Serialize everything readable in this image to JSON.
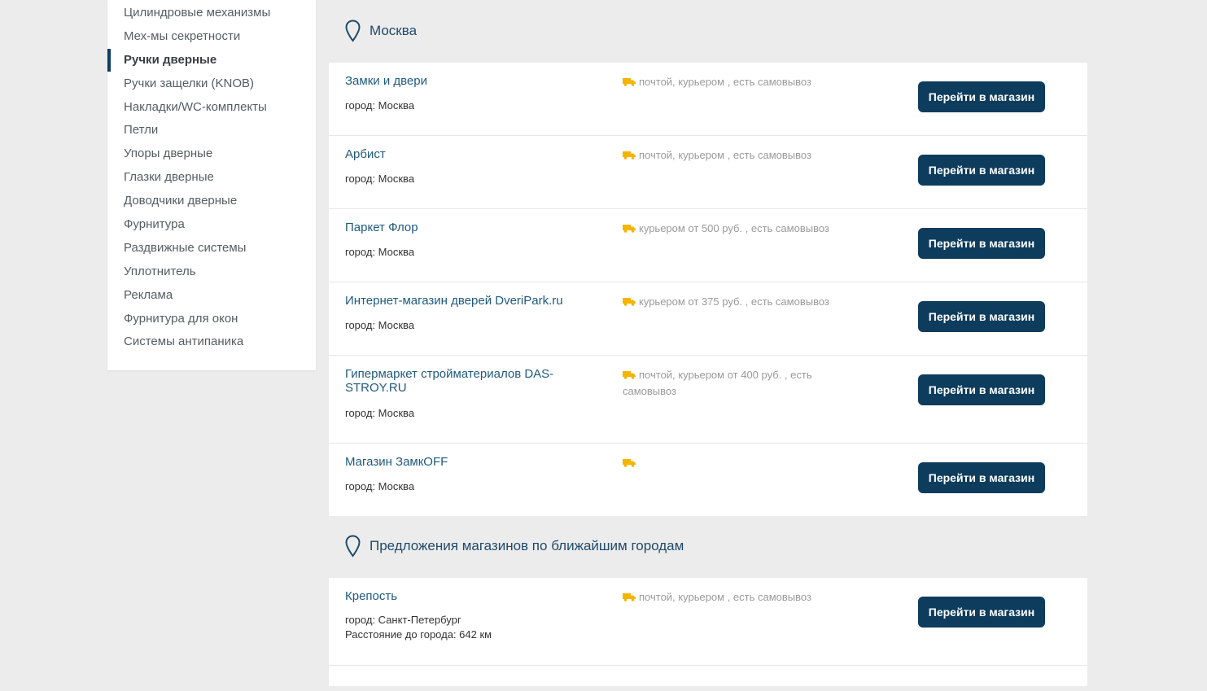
{
  "sidebar": {
    "items": [
      {
        "label": "Цилиндровые механизмы",
        "active": false
      },
      {
        "label": "Мех-мы секретности",
        "active": false
      },
      {
        "label": "Ручки дверные",
        "active": true
      },
      {
        "label": "Ручки защелки (KNOB)",
        "active": false
      },
      {
        "label": "Накладки/WC-комплекты",
        "active": false
      },
      {
        "label": "Петли",
        "active": false
      },
      {
        "label": "Упоры дверные",
        "active": false
      },
      {
        "label": "Глазки дверные",
        "active": false
      },
      {
        "label": "Доводчики дверные",
        "active": false
      },
      {
        "label": "Фурнитура",
        "active": false
      },
      {
        "label": "Раздвижные системы",
        "active": false
      },
      {
        "label": "Уплотнитель",
        "active": false
      },
      {
        "label": "Реклама",
        "active": false
      },
      {
        "label": "Фурнитура для окон",
        "active": false
      },
      {
        "label": "Системы антипаника",
        "active": false
      }
    ]
  },
  "moscow": {
    "title": "Москва",
    "shops": [
      {
        "name": "Замки и двери",
        "city": "город: Москва",
        "delivery": "почтой, курьером , есть самовывоз",
        "button": "Перейти в магазин"
      },
      {
        "name": "Арбист",
        "city": "город: Москва",
        "delivery": "почтой, курьером , есть самовывоз",
        "button": "Перейти в магазин"
      },
      {
        "name": "Паркет Флор",
        "city": "город: Москва",
        "delivery": "курьером от 500 руб. , есть самовывоз",
        "button": "Перейти в магазин"
      },
      {
        "name": "Интернет-магазин дверей DveriPark.ru",
        "city": "город: Москва",
        "delivery": "курьером от 375 руб. , есть самовывоз",
        "button": "Перейти в магазин"
      },
      {
        "name": "Гипермаркет стройматериалов DAS-STROY.RU",
        "city": "город: Москва",
        "delivery": "почтой, курьером от 400 руб. , есть самовывоз",
        "button": "Перейти в магазин"
      },
      {
        "name": "Магазин ЗамкOFF",
        "city": "город: Москва",
        "delivery": "",
        "button": "Перейти в магазин"
      }
    ]
  },
  "nearby": {
    "title": "Предложения магазинов по ближайшим городам",
    "shops": [
      {
        "name": "Крепость",
        "city": "город: Санкт-Петербург",
        "distance": "Расстояние до города: 642 км",
        "delivery": "почтой, курьером , есть самовывоз",
        "button": "Перейти в магазин"
      }
    ]
  },
  "colors": {
    "accent": "#0d3c5d",
    "link": "#1f5a7e",
    "truck": "#f5b400",
    "background": "#ececec"
  },
  "icons": {
    "section": "map-pin-icon",
    "delivery": "truck-icon"
  }
}
